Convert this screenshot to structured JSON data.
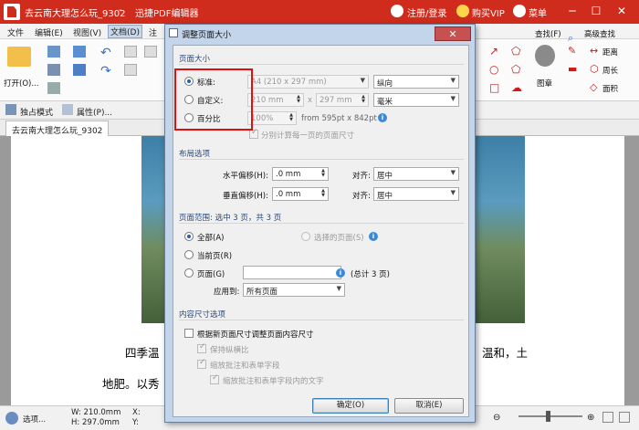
{
  "app": {
    "doc_title": "去云南大理怎么玩_9302",
    "app_name": "迅捷PDF编辑器",
    "login": "注册/登录",
    "vip": "购买VIP",
    "menu": "菜单"
  },
  "menubar": [
    "文件",
    "编辑(E)",
    "视图(V)",
    "文档(D)",
    "注"
  ],
  "ribbon": {
    "open": "打开(O)...",
    "find": "查找(F)",
    "adv_find": "高级查找",
    "image": "图章",
    "distance": "距离",
    "perimeter": "周长",
    "area": "面积"
  },
  "subbar": {
    "exclusive": "独占模式",
    "properties": "属性(P)..."
  },
  "doctab": "去云南大理怎么玩_9302",
  "doc": {
    "line1a": "四季温",
    "line1b": "温和，土",
    "line2": "地肥。以秀"
  },
  "status": {
    "options": "选项...",
    "w": "W: 210.0mm",
    "h": "H: 297.0mm",
    "x": "X:",
    "y": "Y:"
  },
  "dialog": {
    "title": "调整页面大小",
    "close": "✕",
    "sec_size": "页面大小",
    "standard": "标准:",
    "custom": "自定义:",
    "percent": "百分比",
    "paper": "A4 (210 x 297 mm)",
    "orientation": "纵向",
    "w_val": "210 mm",
    "x": "x",
    "h_val": "297 mm",
    "unit": "毫米",
    "pct_val": "100%",
    "from": "from 595pt x 842pt",
    "separate": "分别计算每一页的页面尺寸",
    "sec_layout": "布局选项",
    "h_offset": "水平偏移(H):",
    "v_offset": "垂直偏移(H):",
    "offset_val": ".0 mm",
    "align": "对齐:",
    "center": "居中",
    "sec_range": "页面范围: 选中 3 页，共 3 页",
    "all": "全部(A)",
    "selected_pages": "选择的页面(S)",
    "current": "当前页(R)",
    "pages": "页面(G)",
    "total": "(总计 3 页)",
    "apply_to": "应用到:",
    "all_pages": "所有页面",
    "sec_content": "内容尺寸选项",
    "resize_content": "根据新页面尺寸调整页面内容尺寸",
    "keep_ratio": "保持纵横比",
    "scale_annot": "缩放批注和表单字段",
    "scale_annot_text": "缩放批注和表单字段内的文字",
    "ok": "确定(O)",
    "cancel": "取消(E)"
  }
}
